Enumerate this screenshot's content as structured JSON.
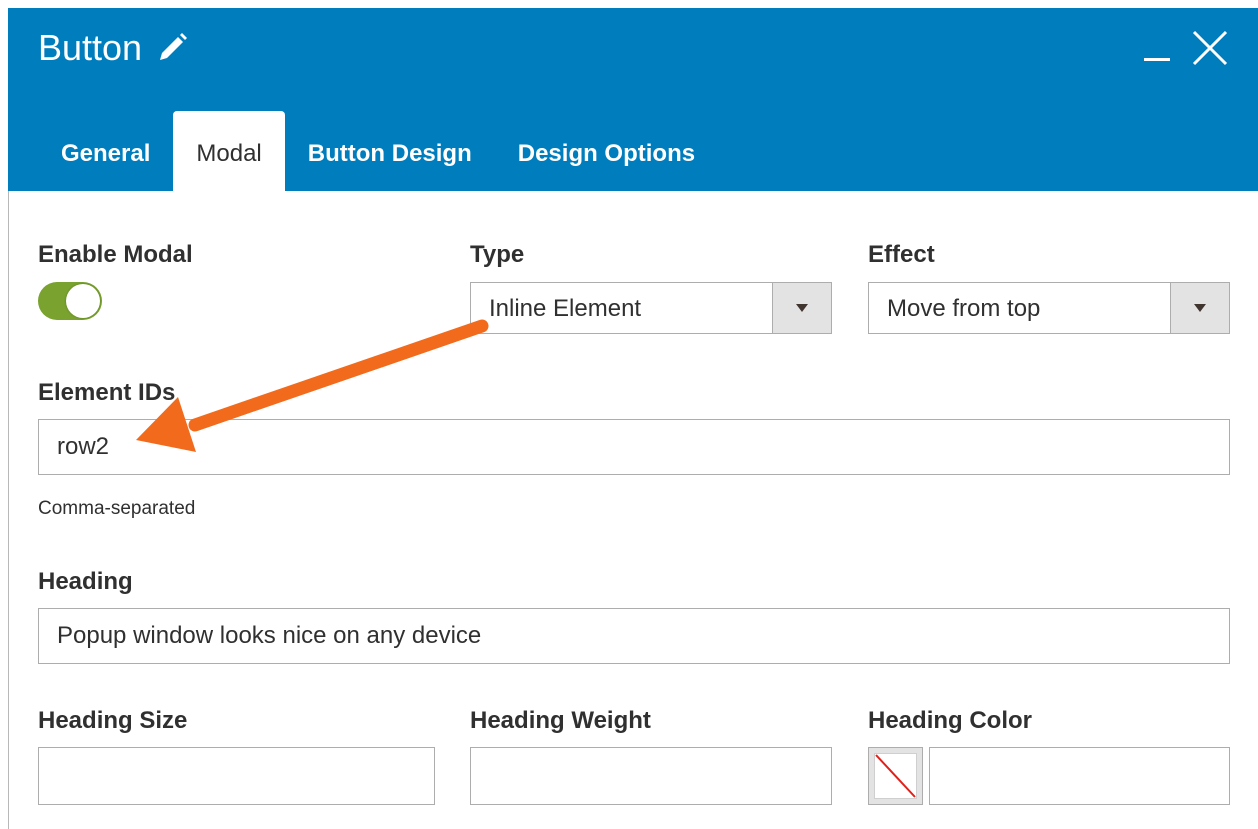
{
  "header": {
    "title": "Button",
    "tabs": [
      {
        "label": "General"
      },
      {
        "label": "Modal"
      },
      {
        "label": "Button Design"
      },
      {
        "label": "Design Options"
      }
    ],
    "active_tab": "Modal"
  },
  "form": {
    "enable_modal": {
      "label": "Enable Modal",
      "value": true
    },
    "type": {
      "label": "Type",
      "value": "Inline Element"
    },
    "effect": {
      "label": "Effect",
      "value": "Move from top"
    },
    "element_ids": {
      "label": "Element IDs",
      "value": "row2",
      "note": "Comma-separated"
    },
    "heading": {
      "label": "Heading",
      "value": "Popup window looks nice on any device"
    },
    "heading_size": {
      "label": "Heading Size",
      "value": ""
    },
    "heading_weight": {
      "label": "Heading Weight",
      "value": ""
    },
    "heading_color": {
      "label": "Heading Color",
      "value": ""
    }
  },
  "colors": {
    "header_bg": "#007dbd",
    "toggle_on": "#79a22e",
    "annotation_arrow": "#f26b1d"
  },
  "icons": [
    "pencil-icon",
    "minimize-icon",
    "close-icon",
    "chevron-down-icon",
    "no-color-icon"
  ]
}
